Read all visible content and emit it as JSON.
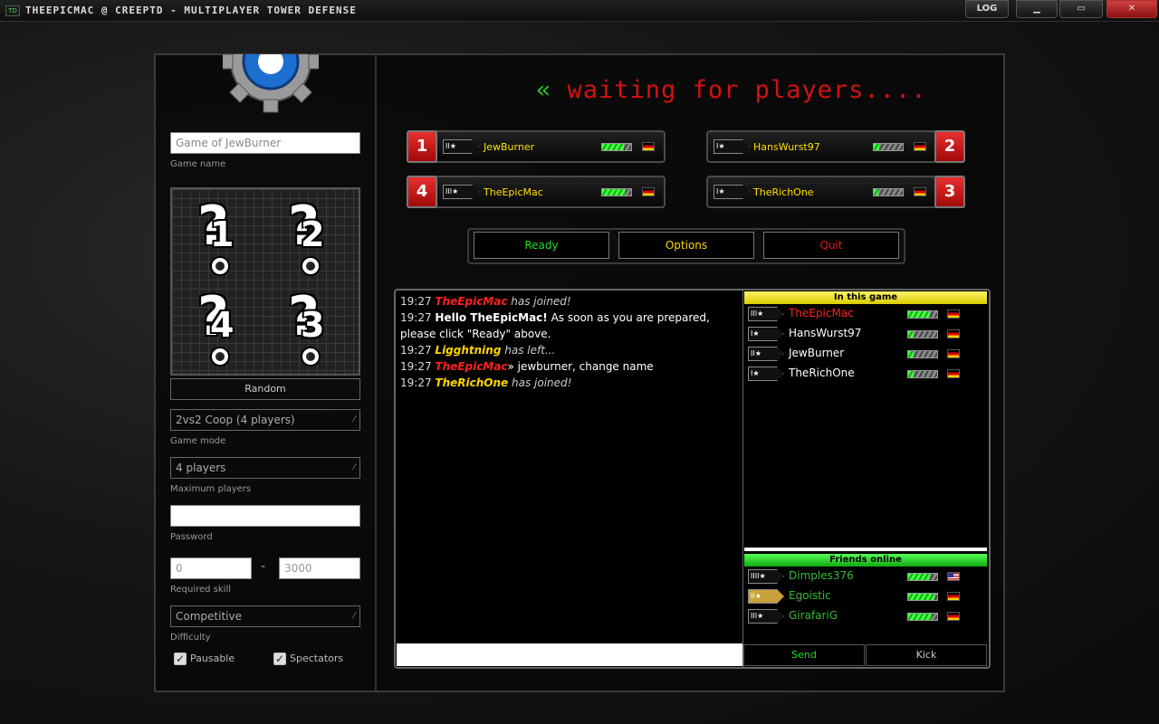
{
  "window": {
    "title": "THEEPICMAC @ CREEPTD - MULTIPLAYER TOWER DEFENSE",
    "log_label": "LOG",
    "minimize": "▁",
    "maximize": "▭",
    "close": "✕"
  },
  "settings": {
    "game_name_value": "Game of JewBurner",
    "game_name_label": "Game name",
    "map_slots": [
      "1",
      "2",
      "4",
      "3"
    ],
    "random_label": "Random",
    "game_mode_value": "2vs2 Coop (4 players)",
    "game_mode_label": "Game mode",
    "max_players_value": "4 players",
    "max_players_label": "Maximum players",
    "password_value": "",
    "password_label": "Password",
    "skill_min": "0",
    "skill_sep": "-",
    "skill_max": "3000",
    "skill_label": "Required skill",
    "difficulty_value": "Competitive",
    "difficulty_label": "Difficulty",
    "pausable_label": "Pausable",
    "spectators_label": "Spectators"
  },
  "status": {
    "arrows": "«",
    "text": " waiting for players...."
  },
  "players": [
    {
      "slot": "1",
      "name": "JewBurner",
      "rank": "II★",
      "skill": 0.75,
      "color": "#ffe000"
    },
    {
      "slot": "2",
      "name": "HansWurst97",
      "rank": "I★",
      "skill": 0.2,
      "color": "#ffe000"
    },
    {
      "slot": "4",
      "name": "TheEpicMac",
      "rank": "III★",
      "skill": 0.8,
      "color": "#ffe000"
    },
    {
      "slot": "3",
      "name": "TheRichOne",
      "rank": "I★",
      "skill": 0.15,
      "color": "#ffe000"
    }
  ],
  "buttons": {
    "ready": "Ready",
    "options": "Options",
    "quit": "Quit",
    "ready_color": "#22dd22",
    "options_color": "#ffd700",
    "quit_color": "#ee1111"
  },
  "chat": {
    "lines": [
      {
        "time": "19:27",
        "name": "TheEpicMac",
        "rest": " has joined!"
      },
      {
        "time": "19:27",
        "bold": "Hello TheEpicMac!",
        "rest": " As soon as you are prepared, please click \"Ready\" above."
      },
      {
        "time": "19:27",
        "name": "Ligghtning",
        "rest": " has left..."
      },
      {
        "time": "19:27",
        "name": "TheEpicMac",
        "sep": "»",
        "rest": " jewburner, change name"
      },
      {
        "time": "19:27",
        "name": "TheRichOne",
        "rest": " has joined!"
      }
    ],
    "input_value": "",
    "send_label": "Send",
    "kick_label": "Kick"
  },
  "in_game": {
    "title": "In this game",
    "users": [
      {
        "name": "TheEpicMac",
        "rank": "III★",
        "skill": 0.75,
        "color": "#ff2020"
      },
      {
        "name": "HansWurst97",
        "rank": "I★",
        "skill": 0.2,
        "color": "#ffffff"
      },
      {
        "name": "JewBurner",
        "rank": "II★",
        "skill": 0.2,
        "color": "#ffffff"
      },
      {
        "name": "TheRichOne",
        "rank": "I★",
        "skill": 0.2,
        "color": "#ffffff"
      }
    ]
  },
  "friends": {
    "title": "Friends online",
    "users": [
      {
        "name": "Dimples376",
        "rank": "IIII★",
        "skill": 0.75,
        "color": "#33bb33",
        "flag": "us"
      },
      {
        "name": "Egoistic",
        "rank": "II★",
        "skill": 0.9,
        "color": "#33bb33",
        "flag": "de"
      },
      {
        "name": "GirafariG",
        "rank": "III★",
        "skill": 0.8,
        "color": "#33bb33",
        "flag": "de"
      }
    ]
  }
}
